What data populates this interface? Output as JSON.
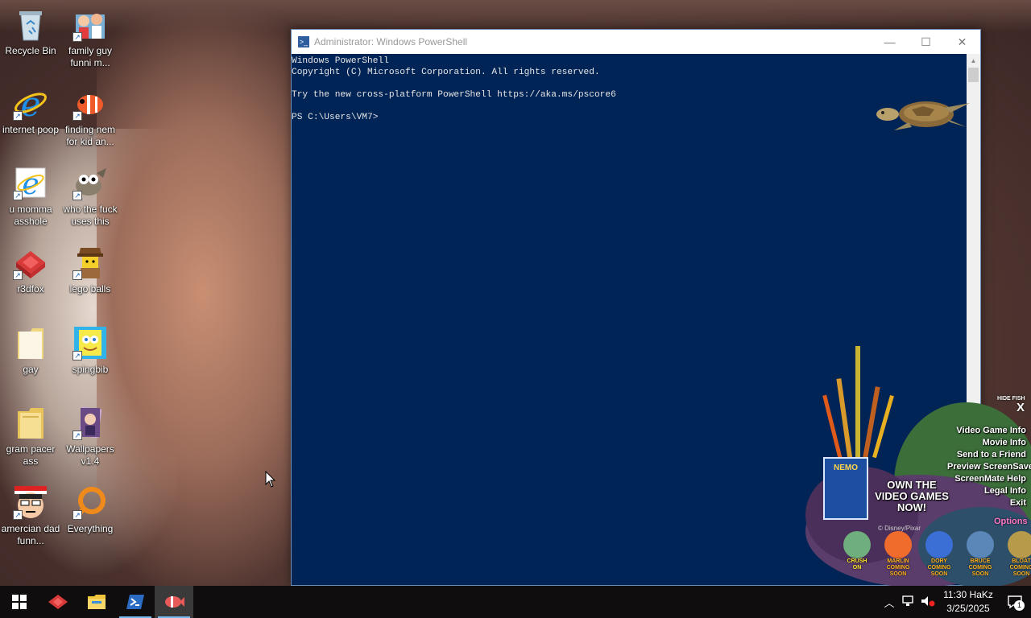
{
  "desktop": {
    "icons": [
      {
        "label": "Recycle Bin",
        "icon": "recycle-bin-icon"
      },
      {
        "label": "family guy funni m...",
        "icon": "family-guy-icon"
      },
      {
        "label": "internet poop",
        "icon": "internet-explorer-icon"
      },
      {
        "label": "finding nem for kid an...",
        "icon": "nemo-fish-icon"
      },
      {
        "label": "u momma asshole",
        "icon": "internet-explorer-icon"
      },
      {
        "label": "who the fuck uses this",
        "icon": "gimp-icon"
      },
      {
        "label": "r3dfox",
        "icon": "r3dfox-icon"
      },
      {
        "label": "lego balls",
        "icon": "lego-figure-icon"
      },
      {
        "label": "gay",
        "icon": "folder-icon"
      },
      {
        "label": "spingbib",
        "icon": "spongebob-icon"
      },
      {
        "label": "gram pacer ass",
        "icon": "folder-icon"
      },
      {
        "label": "Wallpapers v1.4",
        "icon": "wallpapers-icon"
      },
      {
        "label": "amercian dad funn...",
        "icon": "american-dad-icon"
      },
      {
        "label": "Everything",
        "icon": "everything-search-icon"
      }
    ]
  },
  "powershell": {
    "title": "Administrator: Windows PowerShell",
    "lines": [
      "Windows PowerShell",
      "Copyright (C) Microsoft Corporation. All rights reserved.",
      "",
      "Try the new cross-platform PowerShell https://aka.ms/pscore6",
      "",
      "PS C:\\Users\\VM7>"
    ],
    "controls": {
      "minimize": "—",
      "maximize": "☐",
      "close": "✕"
    }
  },
  "screenmate": {
    "hide_label": "HIDE FISH",
    "close": "X",
    "menu": [
      "Video Game Info",
      "Movie Info",
      "Send to a Friend",
      "Preview ScreenSaver",
      "ScreenMate Help",
      "Legal Info",
      "Exit"
    ],
    "options": "Options",
    "promo": "OWN THE VIDEO GAMES NOW!",
    "box_title": "NEMO",
    "copyright": "© Disney/Pixar",
    "characters": [
      {
        "name": "CRUSH",
        "status": "ON",
        "color": "#6fae7d"
      },
      {
        "name": "MARLIN",
        "status": "COMING\nSOON",
        "color": "#f06c2c"
      },
      {
        "name": "DORY",
        "status": "COMING\nSOON",
        "color": "#3b6fd6"
      },
      {
        "name": "BRUCE",
        "status": "COMING\nSOON",
        "color": "#5a86b8"
      },
      {
        "name": "BLOAT",
        "status": "COMING\nSOON",
        "color": "#b89b4a"
      }
    ]
  },
  "taskbar": {
    "start": "windows-start-icon",
    "apps": [
      "r3dfox-icon",
      "file-explorer-icon",
      "powershell-icon",
      "nemo-screenmate-icon"
    ],
    "clock_time": "11:30 HaKz",
    "clock_date": "3/25/2025",
    "notification_count": "1"
  }
}
